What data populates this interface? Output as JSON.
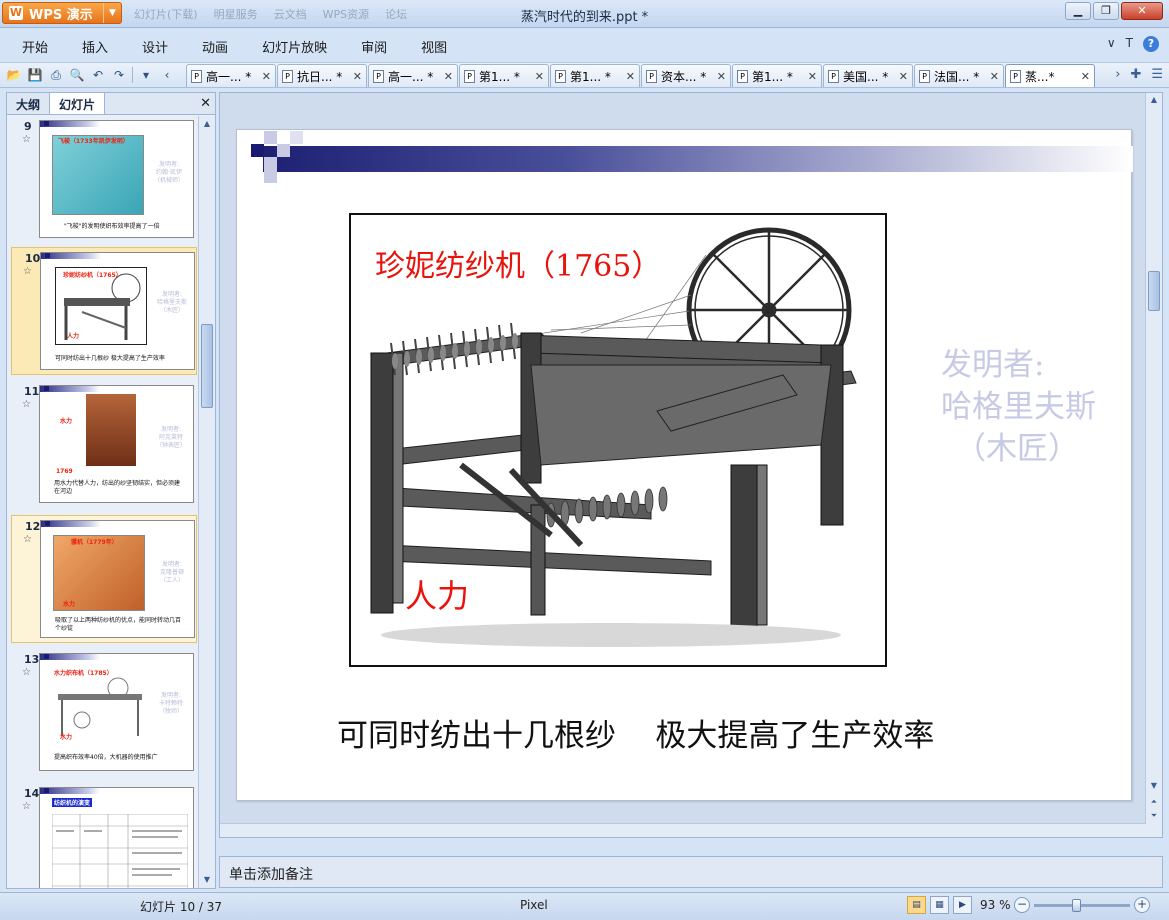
{
  "app": {
    "brand": "WPS 演示",
    "window_title": "蒸汽时代的到来.ppt *",
    "colors": {
      "accent": "#e8731a",
      "slide_red": "#e8130c",
      "inventor_gray": "#c7cae4",
      "band_dark": "#1e2073"
    }
  },
  "ghost_tabs": [
    "幻灯片(下载)",
    "明星服务",
    "云文档",
    "WPS资源",
    "论坛"
  ],
  "menu": [
    "开始",
    "插入",
    "设计",
    "动画",
    "幻灯片放映",
    "审阅",
    "视图"
  ],
  "menu_right": {
    "collapse": "∨",
    "skin": "T",
    "help": "?"
  },
  "toolbar_icons": [
    "open-icon",
    "save-icon",
    "print-icon",
    "print-preview-icon",
    "undo-icon",
    "redo-icon",
    "dropdown-icon",
    "tabs-left-icon"
  ],
  "doc_tabs": [
    {
      "label": "高一...",
      "modified": "*"
    },
    {
      "label": "抗日...",
      "modified": "*"
    },
    {
      "label": "高一...",
      "modified": "*"
    },
    {
      "label": "第1...",
      "modified": "*"
    },
    {
      "label": "第1...",
      "modified": "*"
    },
    {
      "label": "资本...",
      "modified": "*"
    },
    {
      "label": "第1...",
      "modified": "*"
    },
    {
      "label": "美国...",
      "modified": "*"
    },
    {
      "label": "法国...",
      "modified": "*"
    },
    {
      "label": "蒸...",
      "modified": "*"
    }
  ],
  "left_panel": {
    "tabs": [
      "大纲",
      "幻灯片"
    ],
    "active_tab": "幻灯片",
    "thumbnails": [
      {
        "number": "9",
        "title": "飞梭（1733年凯伊发明）",
        "side": "发明者:\n约翰·凯伊\n（机械师）",
        "caption": "\"飞梭\"的发明使织布效率提高了一倍"
      },
      {
        "number": "10",
        "title": "珍妮纺纱机（1765）",
        "side": "发明者:\n哈格里夫斯\n（木匠）",
        "caption": "可同时纺出十几根纱  极大提高了生产效率",
        "power": "人力"
      },
      {
        "number": "11",
        "title": "水力",
        "side": "发明者:\n阿克莱特\n（钟表匠）",
        "caption": "用水力代替人力，纺出的纱坚韧结实，但必须建在河边",
        "year": "1769"
      },
      {
        "number": "12",
        "title": "骡机（1779年）",
        "side": "发明者:\n克隆普顿\n（工人）",
        "caption": "吸取了以上两种纺纱机的优点，能同时转动几百个纱锭",
        "power": "水力"
      },
      {
        "number": "13",
        "title": "水力织布机（1785）",
        "side": "发明者:\n卡特赖特\n（牧师）",
        "caption": "提高织布效率40倍，大机器的使用推广",
        "power": "水力"
      },
      {
        "number": "14",
        "title": "纺织机的演变"
      }
    ]
  },
  "slide": {
    "title": "珍妮纺纱机（1765）",
    "power_label": "人力",
    "inventor_lines": [
      "发明者:",
      "哈格里夫斯",
      "（木匠）"
    ],
    "caption": "可同时纺出十几根纱    极大提高了生产效率"
  },
  "notes_placeholder": "单击添加备注",
  "status": {
    "slide_label": "幻灯片 10 / 37",
    "template": "Pixel",
    "zoom": "93 %",
    "zoom_level": 0.45
  }
}
